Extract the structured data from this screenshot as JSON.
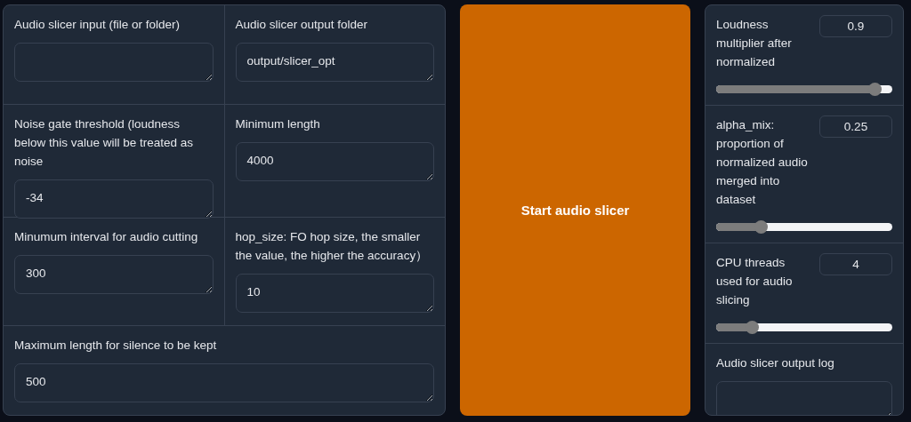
{
  "left_panel": {
    "rows": [
      {
        "fields": [
          {
            "label": "Audio slicer input (file or folder)"
          },
          {
            "label": "Audio slicer output folder",
            "value": "output/slicer_opt"
          }
        ]
      },
      {
        "fields": [
          {
            "label": "Noise gate threshold (loudness below this value will be treated as noise",
            "value": "-34"
          },
          {
            "label": "Minimum length",
            "value": "4000"
          }
        ]
      },
      {
        "fields": [
          {
            "label": "Minumum interval for audio cutting",
            "value": "300"
          },
          {
            "label": "hop_size: FO hop size, the smaller the value, the higher the accuracy）",
            "value": "10"
          }
        ]
      },
      {
        "fields": [
          {
            "label": "Maximum length for silence to be kept",
            "value": "500"
          }
        ]
      }
    ]
  },
  "start_button": {
    "label": "Start audio slicer"
  },
  "right_panel": {
    "sliders": [
      {
        "label": "Loudness multiplier after normalized",
        "value": "0.9",
        "level": 0.9
      },
      {
        "label": "alpha_mix: proportion of normalized audio merged into dataset",
        "value": "0.25",
        "level": 0.25
      },
      {
        "label": "CPU threads used for audio slicing",
        "value": "4",
        "level": 0.2
      }
    ],
    "output_log": {
      "label": "Audio slicer output log"
    }
  }
}
